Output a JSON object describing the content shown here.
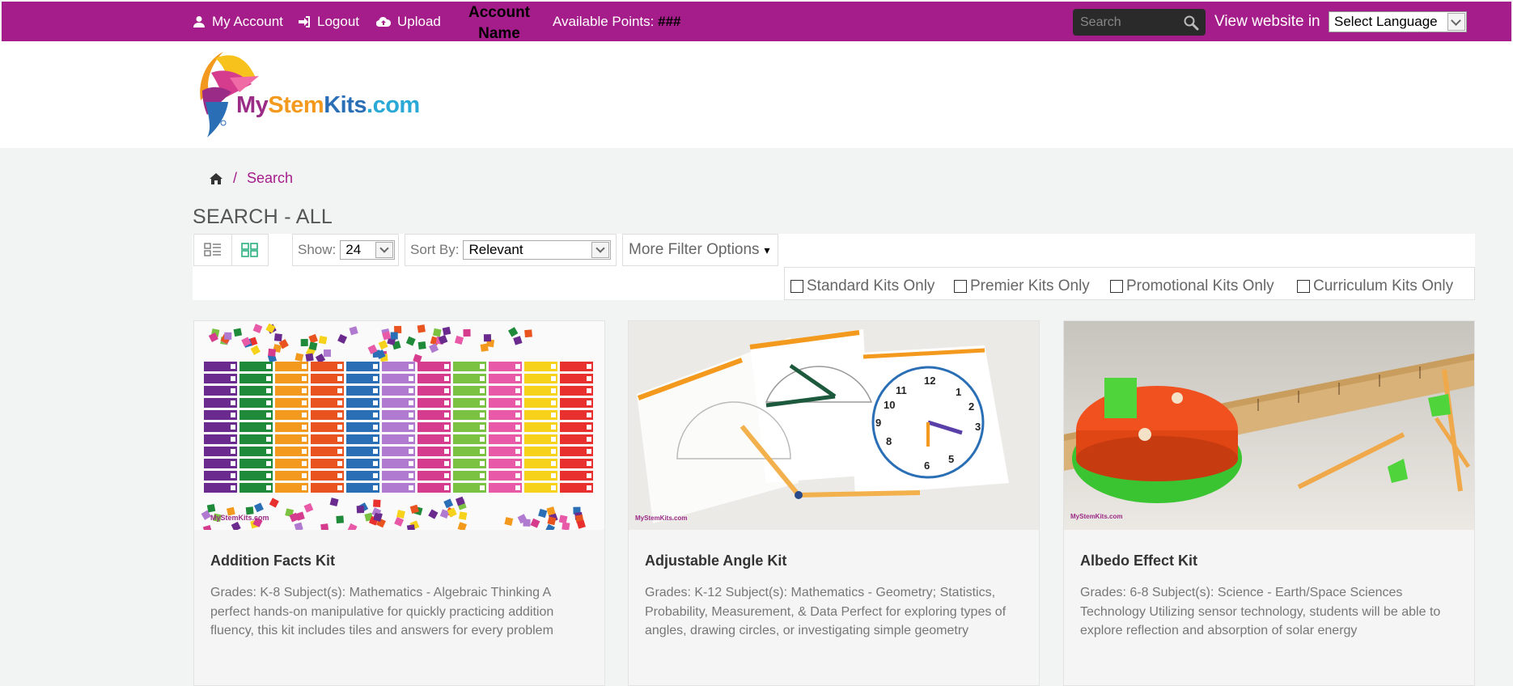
{
  "topbar": {
    "my_account": "My Account",
    "logout": "Logout",
    "upload": "Upload",
    "account_name": "Account Name",
    "points_label": "Available Points:",
    "points_value": "###",
    "search_placeholder": "Search",
    "view_website_in": "View website in",
    "language_select": "Select Language"
  },
  "logo": {
    "my": "My",
    "stem": "Stem",
    "kits": "Kits",
    "com": ".com"
  },
  "breadcrumb": {
    "current": "Search",
    "separator": "/"
  },
  "page_title": "SEARCH - ALL",
  "toolbar": {
    "show_label": "Show:",
    "show_value": "24",
    "sort_label": "Sort By:",
    "sort_value": "Relevant",
    "more_filters": "More Filter Options",
    "caret": "▾"
  },
  "filters": [
    {
      "label": "Standard Kits Only",
      "checked": false
    },
    {
      "label": "Premier Kits Only",
      "checked": false
    },
    {
      "label": "Promotional Kits Only",
      "checked": false
    },
    {
      "label": "Curriculum Kits Only",
      "checked": false
    }
  ],
  "products": [
    {
      "name": "Addition Facts Kit",
      "desc": "Grades: K-8 Subject(s): Mathematics - Algebraic Thinking  A perfect hands-on manipulative for quickly practicing addition fluency, this kit includes tiles and answers for every problem"
    },
    {
      "name": "Adjustable Angle Kit",
      "desc": "Grades: K-12 Subject(s): Mathematics - Geometry; Statistics, Probability, Measurement, & Data   Perfect for exploring types of angles, drawing circles, or investigating simple geometry"
    },
    {
      "name": "Albedo Effect Kit",
      "desc": "Grades: 6-8 Subject(s): Science - Earth/Space Sciences Technology   Utilizing sensor technology, students will be able to explore reflection and absorption of solar energy"
    }
  ],
  "colors": {
    "brand": "#a51d8a",
    "topbar_text": "#ffffff",
    "page_bg": "#f2f3f3",
    "accent_green": "#2bb07f"
  },
  "image_watermark": "MyStemKits.com"
}
